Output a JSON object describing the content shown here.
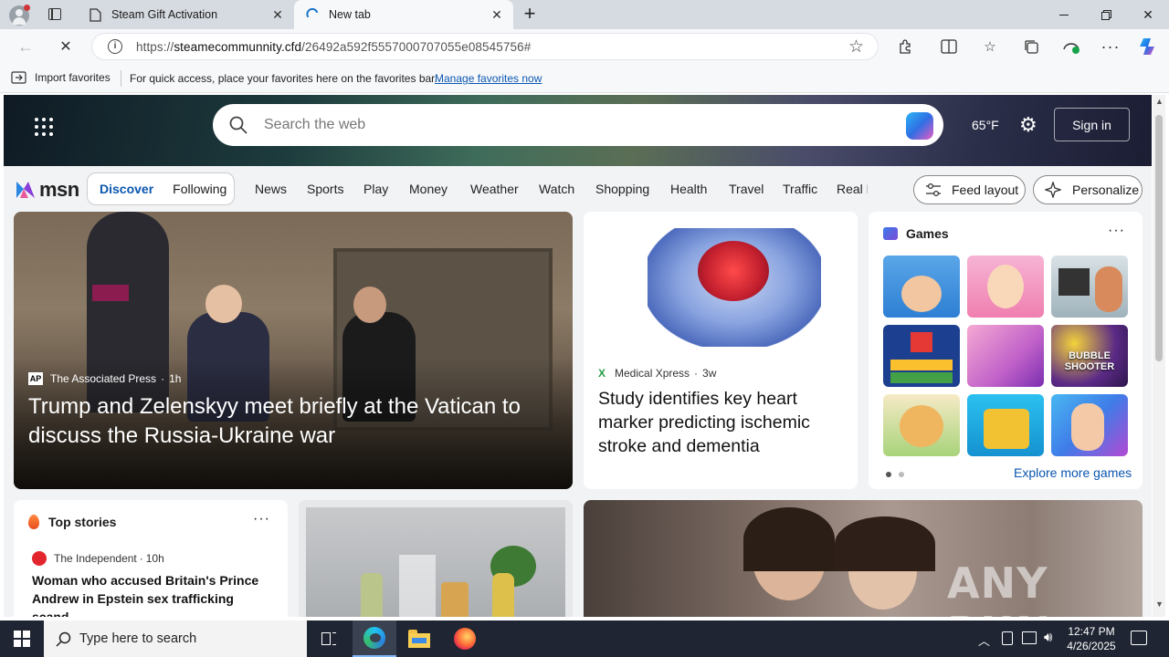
{
  "browser": {
    "tabs": [
      {
        "label": "Steam Gift Activation"
      },
      {
        "label": "New tab"
      }
    ],
    "url_prefix": "https://",
    "url_domain": "steamecommunnity.cfd",
    "url_path": "/26492a592f5557000707055e08545756#",
    "favorites_bar": {
      "import_label": "Import favorites",
      "hint": "For quick access, place your favorites here on the favorites bar.",
      "manage_link": "Manage favorites now"
    }
  },
  "msn": {
    "search_placeholder": "Search the web",
    "weather": "65°F",
    "sign_in": "Sign in",
    "logo": "msn",
    "tabs": [
      "Discover",
      "Following"
    ],
    "nav": [
      "News",
      "Sports",
      "Play",
      "Money",
      "Weather",
      "Watch",
      "Shopping",
      "Health",
      "Travel",
      "Traffic",
      "Real E"
    ],
    "feed_layout": "Feed layout",
    "personalize": "Personalize",
    "hero": {
      "source": "The Associated Press",
      "age": "1h",
      "title": "Trump and Zelenskyy meet briefly at the Vatican to discuss the Russia-Ukraine war"
    },
    "card2": {
      "source": "Medical Xpress",
      "age": "3w",
      "title": "Study identifies key heart marker predicting ischemic stroke and dementia"
    },
    "games": {
      "title": "Games",
      "more": "Explore more games",
      "thumb_text": "BUBBLE SHOOTER"
    },
    "top_stories": {
      "title": "Top stories",
      "source": "The Independent",
      "age": "10h",
      "headline": "Woman who accused Britain's Prince Andrew in Epstein sex trafficking scand..."
    },
    "watermark": "ANY RUN"
  },
  "taskbar": {
    "search_placeholder": "Type here to search",
    "time": "12:47 PM",
    "date": "4/26/2025"
  }
}
